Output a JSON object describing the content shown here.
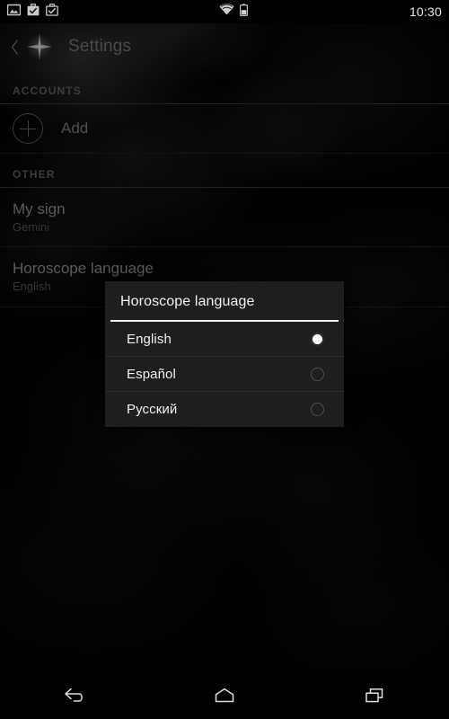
{
  "status_bar": {
    "left_icons": [
      {
        "name": "image-icon",
        "label": "Image"
      },
      {
        "name": "work-badge-icon",
        "label": "Work profile"
      },
      {
        "name": "work-badge-outline-icon",
        "label": "Work profile outline"
      }
    ],
    "right_icons": [
      {
        "name": "wifi-icon",
        "label": "Wi-Fi"
      },
      {
        "name": "battery-icon",
        "label": "Battery"
      }
    ],
    "clock": "10:30"
  },
  "action_bar": {
    "up_icon": "chevron-left-icon",
    "app_icon": "star-sparkle-icon",
    "title": "Settings"
  },
  "settings": {
    "sections": [
      {
        "header": "ACCOUNTS",
        "add_row": {
          "icon": "plus-circle-icon",
          "label": "Add"
        }
      },
      {
        "header": "OTHER",
        "rows": [
          {
            "title": "My sign",
            "summary": "Gemini"
          },
          {
            "title": "Horoscope language",
            "summary": "English"
          }
        ]
      }
    ]
  },
  "dialog": {
    "title": "Horoscope language",
    "options": [
      {
        "label": "English",
        "selected": true
      },
      {
        "label": "Español",
        "selected": false
      },
      {
        "label": "Русский",
        "selected": false
      }
    ]
  },
  "nav_bar": {
    "buttons": [
      {
        "name": "back-button",
        "label": "Back"
      },
      {
        "name": "home-button",
        "label": "Home"
      },
      {
        "name": "recents-button",
        "label": "Recent apps"
      }
    ]
  },
  "colors": {
    "background": "#000000",
    "dialog_background": "#1e1e1e",
    "accent_text": "#f0f0f0",
    "muted_text": "#5a5a5a",
    "section_header": "#3c3c3c"
  }
}
